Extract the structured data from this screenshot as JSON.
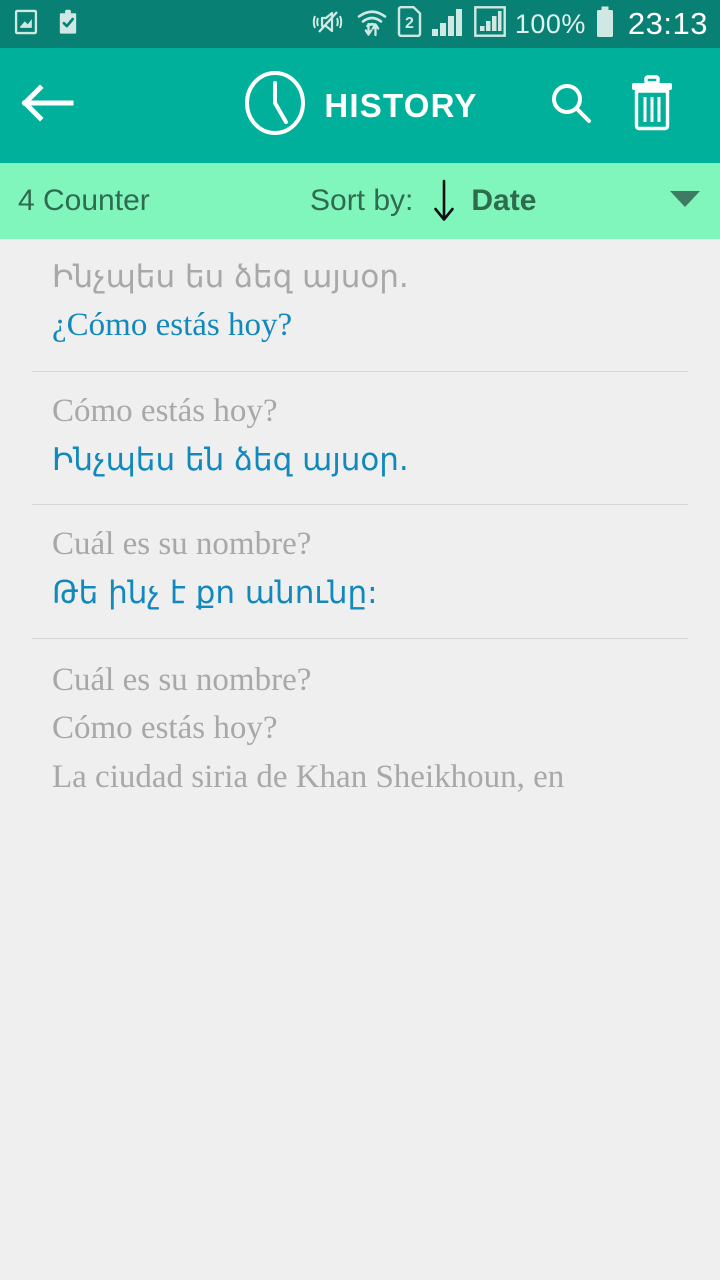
{
  "statusbar": {
    "left_icons": [
      "image-icon",
      "clipboard-check-icon"
    ],
    "right_icons": [
      "mute-vibrate-icon",
      "wifi-transfer-icon",
      "sim2-icon",
      "signal-bars-icon",
      "signal-boxed-icon"
    ],
    "battery_text": "100%",
    "battery_icon": "battery-full-icon",
    "clock": "23:13"
  },
  "appbar": {
    "back_icon": "back-arrow-icon",
    "clock_icon": "clock-icon",
    "title": "HISTORY",
    "search_icon": "search-icon",
    "delete_icon": "trash-icon"
  },
  "sortbar": {
    "counter": "4 Counter",
    "sort_label": "Sort by:",
    "direction_icon": "arrow-down-icon",
    "sort_value": "Date",
    "caret_icon": "chevron-down-icon"
  },
  "history": {
    "items": [
      {
        "source": "Ինչպես ես ձեզ այսօր.",
        "source_script": "armn",
        "target": "¿Cómo estás hoy?",
        "target_script": "latn"
      },
      {
        "source": "Cómo estás hoy?",
        "source_script": "latn",
        "target": "Ինչպես են ձեզ այսօր.",
        "target_script": "armn"
      },
      {
        "source": "Cuál es su nombre?",
        "source_script": "latn",
        "target": "Թե ինչ է քո անունը:",
        "target_script": "armn"
      }
    ],
    "partial_item": {
      "line1": "Cuál es su nombre?",
      "line2": "Cómo estás hoy?",
      "line3": "La ciudad siria de Khan Sheikhoun, en"
    }
  },
  "colors": {
    "statusbar_bg": "#088073",
    "appbar_bg": "#00b09b",
    "sortbar_bg": "#80f5bc",
    "page_bg": "#efefef",
    "source_text": "#a8a8a8",
    "target_text": "#1189bd",
    "sortbar_text": "#2f6b4f"
  }
}
